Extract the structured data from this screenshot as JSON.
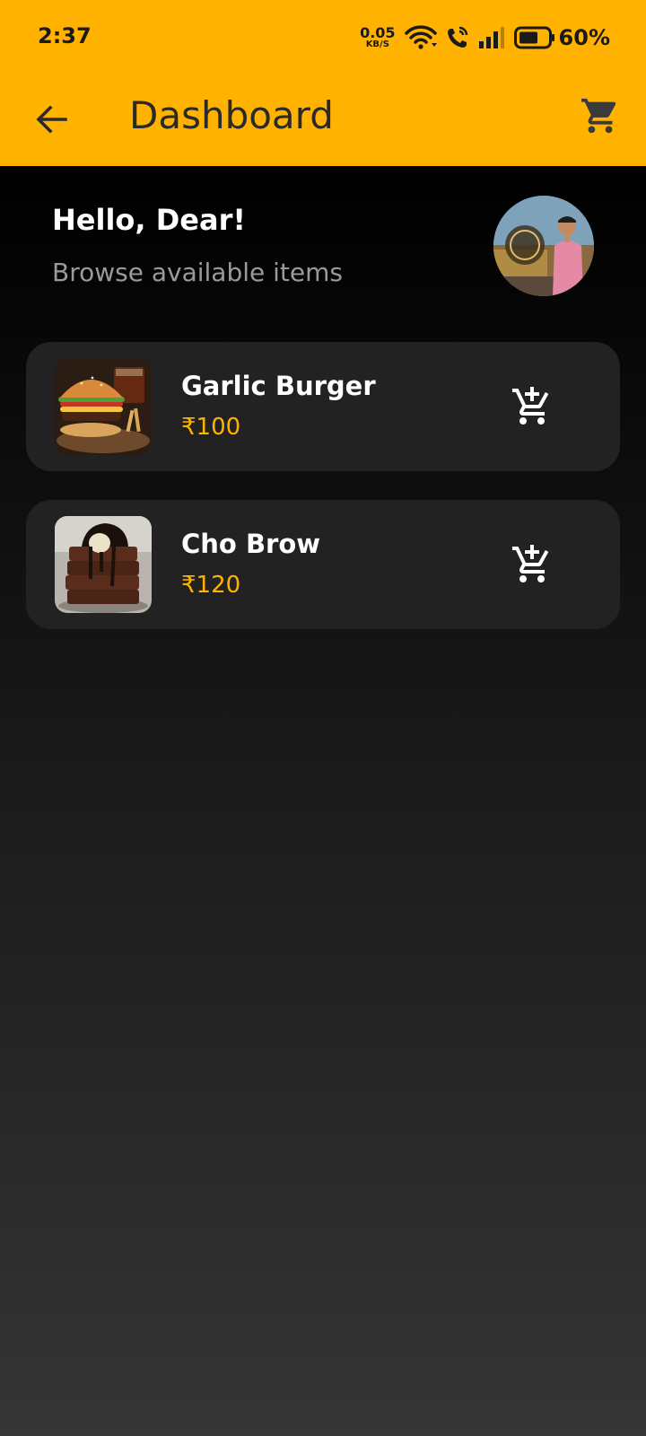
{
  "status_bar": {
    "time": "2:37",
    "net_speed_value": "0.05",
    "net_speed_unit": "KB/S",
    "battery_percent": "60%",
    "icons": [
      "wifi-icon",
      "volte-call-icon",
      "signal-icon",
      "battery-icon"
    ]
  },
  "app_bar": {
    "title": "Dashboard",
    "back_icon": "arrow-back-icon",
    "cart_icon": "shopping-cart-icon",
    "background": "#FFB300"
  },
  "greeting": {
    "title": "Hello, Dear!",
    "subtitle": "Browse available items"
  },
  "items": [
    {
      "name": "Garlic Burger",
      "price": "₹100",
      "image": "burger-image",
      "action_icon": "add-shopping-cart-icon"
    },
    {
      "name": "Cho Brow",
      "price": "₹120",
      "image": "brownie-image",
      "action_icon": "add-shopping-cart-icon"
    }
  ],
  "colors": {
    "accent": "#FFB300",
    "card": "#222222",
    "text_primary": "#FFFFFF",
    "text_secondary": "#9A9A9A"
  }
}
